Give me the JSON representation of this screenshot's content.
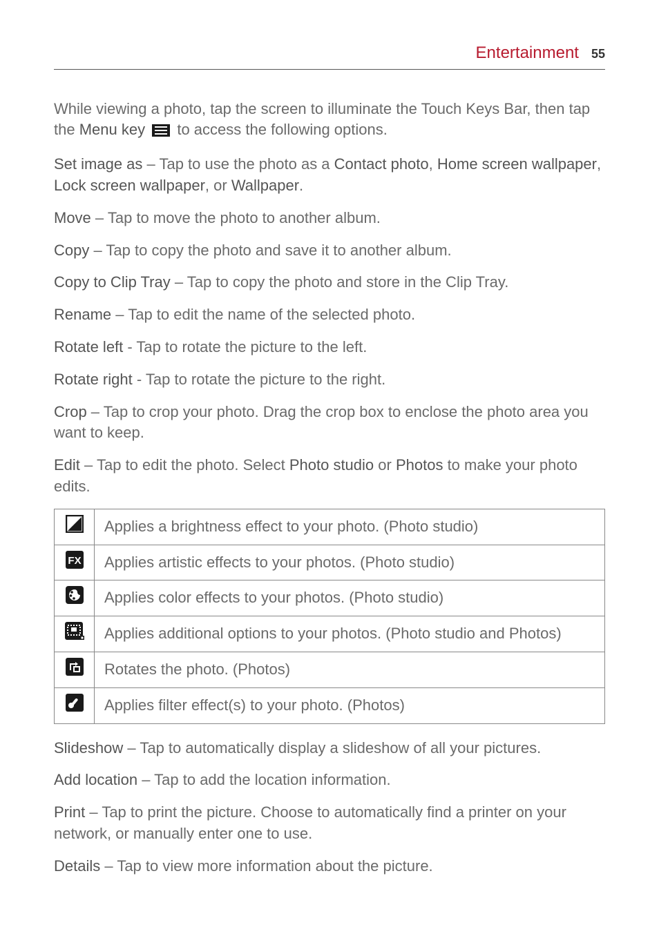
{
  "header": {
    "section": "Entertainment",
    "page": "55"
  },
  "intro": {
    "pre": "While viewing a photo, tap the screen to illuminate the Touch Keys Bar, then tap the ",
    "menu_key": "Menu key",
    "post": " to access the following options."
  },
  "options": {
    "set_image_as": {
      "label": "Set image as",
      "sep": " – Tap to use the photo as a ",
      "t1": "Contact photo",
      "c1": ", ",
      "t2": "Home screen wallpaper",
      "c2": ", ",
      "t3": "Lock screen wallpaper",
      "c3": ", or ",
      "t4": "Wallpaper",
      "end": "."
    },
    "move": {
      "label": "Move",
      "text": " – Tap to move the photo to another album."
    },
    "copy": {
      "label": "Copy",
      "text": " – Tap to copy the photo and save it to another album."
    },
    "copy_clip": {
      "label": "Copy to Clip Tray",
      "text": " – Tap to copy the photo and store in the Clip Tray."
    },
    "rename": {
      "label": "Rename",
      "text": " – Tap to edit the name of the selected photo."
    },
    "rotate_left": {
      "label": "Rotate left",
      "text": " - Tap to rotate the picture to the left."
    },
    "rotate_right": {
      "label": "Rotate right",
      "text": " - Tap to rotate the picture to the right."
    },
    "crop": {
      "label": "Crop",
      "text": " – Tap to crop your photo. Drag the crop box to enclose the photo area you want to keep."
    },
    "edit": {
      "label": "Edit",
      "pre": " – Tap to edit the photo. Select ",
      "t1": "Photo studio",
      "mid": " or ",
      "t2": "Photos",
      "post": " to make your photo edits."
    },
    "slideshow": {
      "label": "Slideshow",
      "text": " – Tap to automatically display a slideshow of all your pictures."
    },
    "add_location": {
      "label": "Add location",
      "text": " – Tap to add the location information."
    },
    "print": {
      "label": "Print",
      "text": " – Tap to print the picture. Choose to automatically find a printer on your network, or manually enter one to use."
    },
    "details": {
      "label": "Details",
      "text": " – Tap to view more information about the picture."
    }
  },
  "effects": [
    {
      "icon": "brightness-icon",
      "desc": "Applies a brightness effect to your photo. (Photo studio)"
    },
    {
      "icon": "fx-icon",
      "desc": "Applies artistic effects to your photos. (Photo studio)"
    },
    {
      "icon": "color-palette-icon",
      "desc": "Applies color effects to your photos. (Photo studio)"
    },
    {
      "icon": "additional-options-icon",
      "desc": "Applies additional options to your photos. (Photo studio and Photos)"
    },
    {
      "icon": "rotate-icon",
      "desc": "Rotates the photo. (Photos)"
    },
    {
      "icon": "filter-pen-icon",
      "desc": "Applies filter effect(s) to your photo. (Photos)"
    }
  ]
}
